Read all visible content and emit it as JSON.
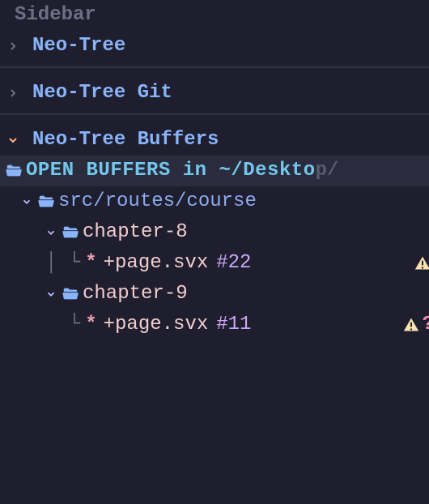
{
  "header": "Sidebar",
  "sources": [
    {
      "label": "Neo-Tree",
      "expanded": false
    },
    {
      "label": "Neo-Tree Git",
      "expanded": false
    },
    {
      "label": "Neo-Tree Buffers",
      "expanded": true
    }
  ],
  "open_buffers": {
    "title": "OPEN BUFFERS in ",
    "path_visible": "~/Deskto",
    "path_cutoff": "p/"
  },
  "tree": {
    "root_path": "src/routes/course",
    "dirs": [
      {
        "name": "chapter-8",
        "files": [
          {
            "modified": "*",
            "name": "+page.svx",
            "buffer": "#22",
            "diag": "warn"
          }
        ]
      },
      {
        "name": "chapter-9",
        "files": [
          {
            "modified": "*",
            "name": "+page.svx",
            "buffer": "#11",
            "diag": "warn",
            "git": "?"
          }
        ]
      }
    ]
  },
  "glyphs": {
    "tree_mid": "│ └",
    "tree_last": "  └"
  }
}
